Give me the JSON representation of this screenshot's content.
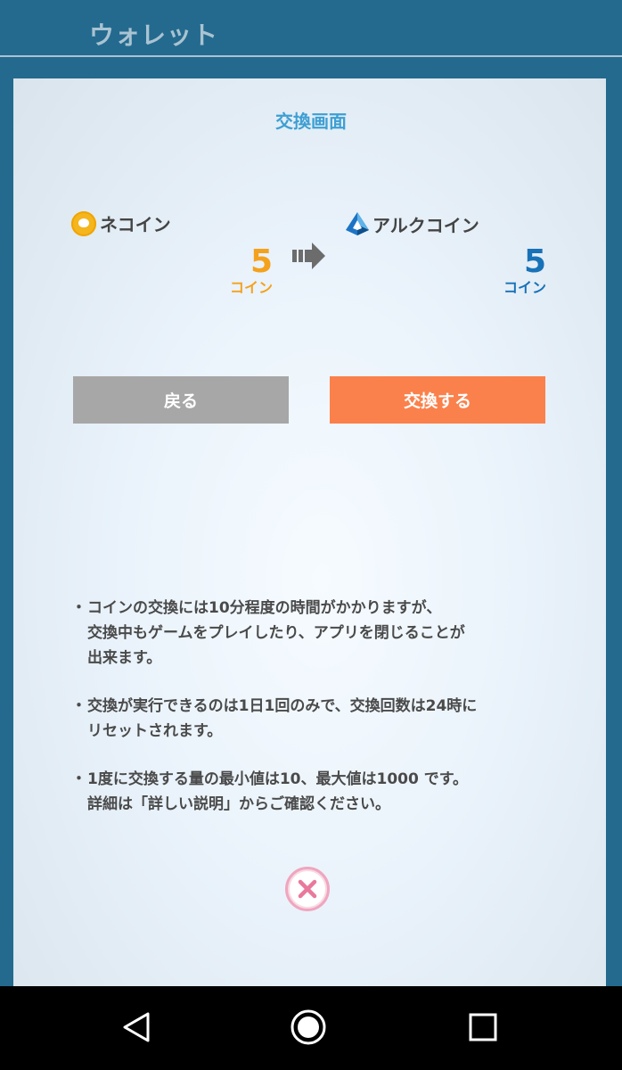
{
  "header": {
    "title": "ウォレット"
  },
  "exchange": {
    "title": "交換画面",
    "from": {
      "name": "ネコイン",
      "amount": "5",
      "unit": "コイン",
      "color": "#f4a21d",
      "icon": "neko-coin-icon"
    },
    "to": {
      "name": "アルクコイン",
      "amount": "5",
      "unit": "コイン",
      "color": "#1872b8",
      "icon": "arc-coin-icon"
    },
    "arrow_icon": "arrow-right-icon"
  },
  "buttons": {
    "back": "戻る",
    "exchange": "交換する"
  },
  "notes": [
    {
      "bullet": "・",
      "lines": [
        "コインの交換には10分程度の時間がかかりますが、",
        "交換中もゲームをプレイしたり、アプリを閉じることが",
        "出来ます。"
      ]
    },
    {
      "bullet": "・",
      "lines": [
        "交換が実行できるのは1日1回のみで、交換回数は24時に",
        "リセットされます。"
      ]
    },
    {
      "bullet": "・",
      "lines": [
        "1度に交換する量の最小値は10、最大値は1000 です。",
        "詳細は「詳しい説明」からご確認ください。"
      ]
    }
  ],
  "close_icon": "close-icon",
  "navbar": {
    "back_icon": "nav-back-icon",
    "home_icon": "nav-home-icon",
    "recent_icon": "nav-recent-icon"
  },
  "colors": {
    "background": "#246a8e",
    "accent_title": "#3d9fd3",
    "back_button": "#a7a7a7",
    "exchange_button": "#fa814b"
  }
}
